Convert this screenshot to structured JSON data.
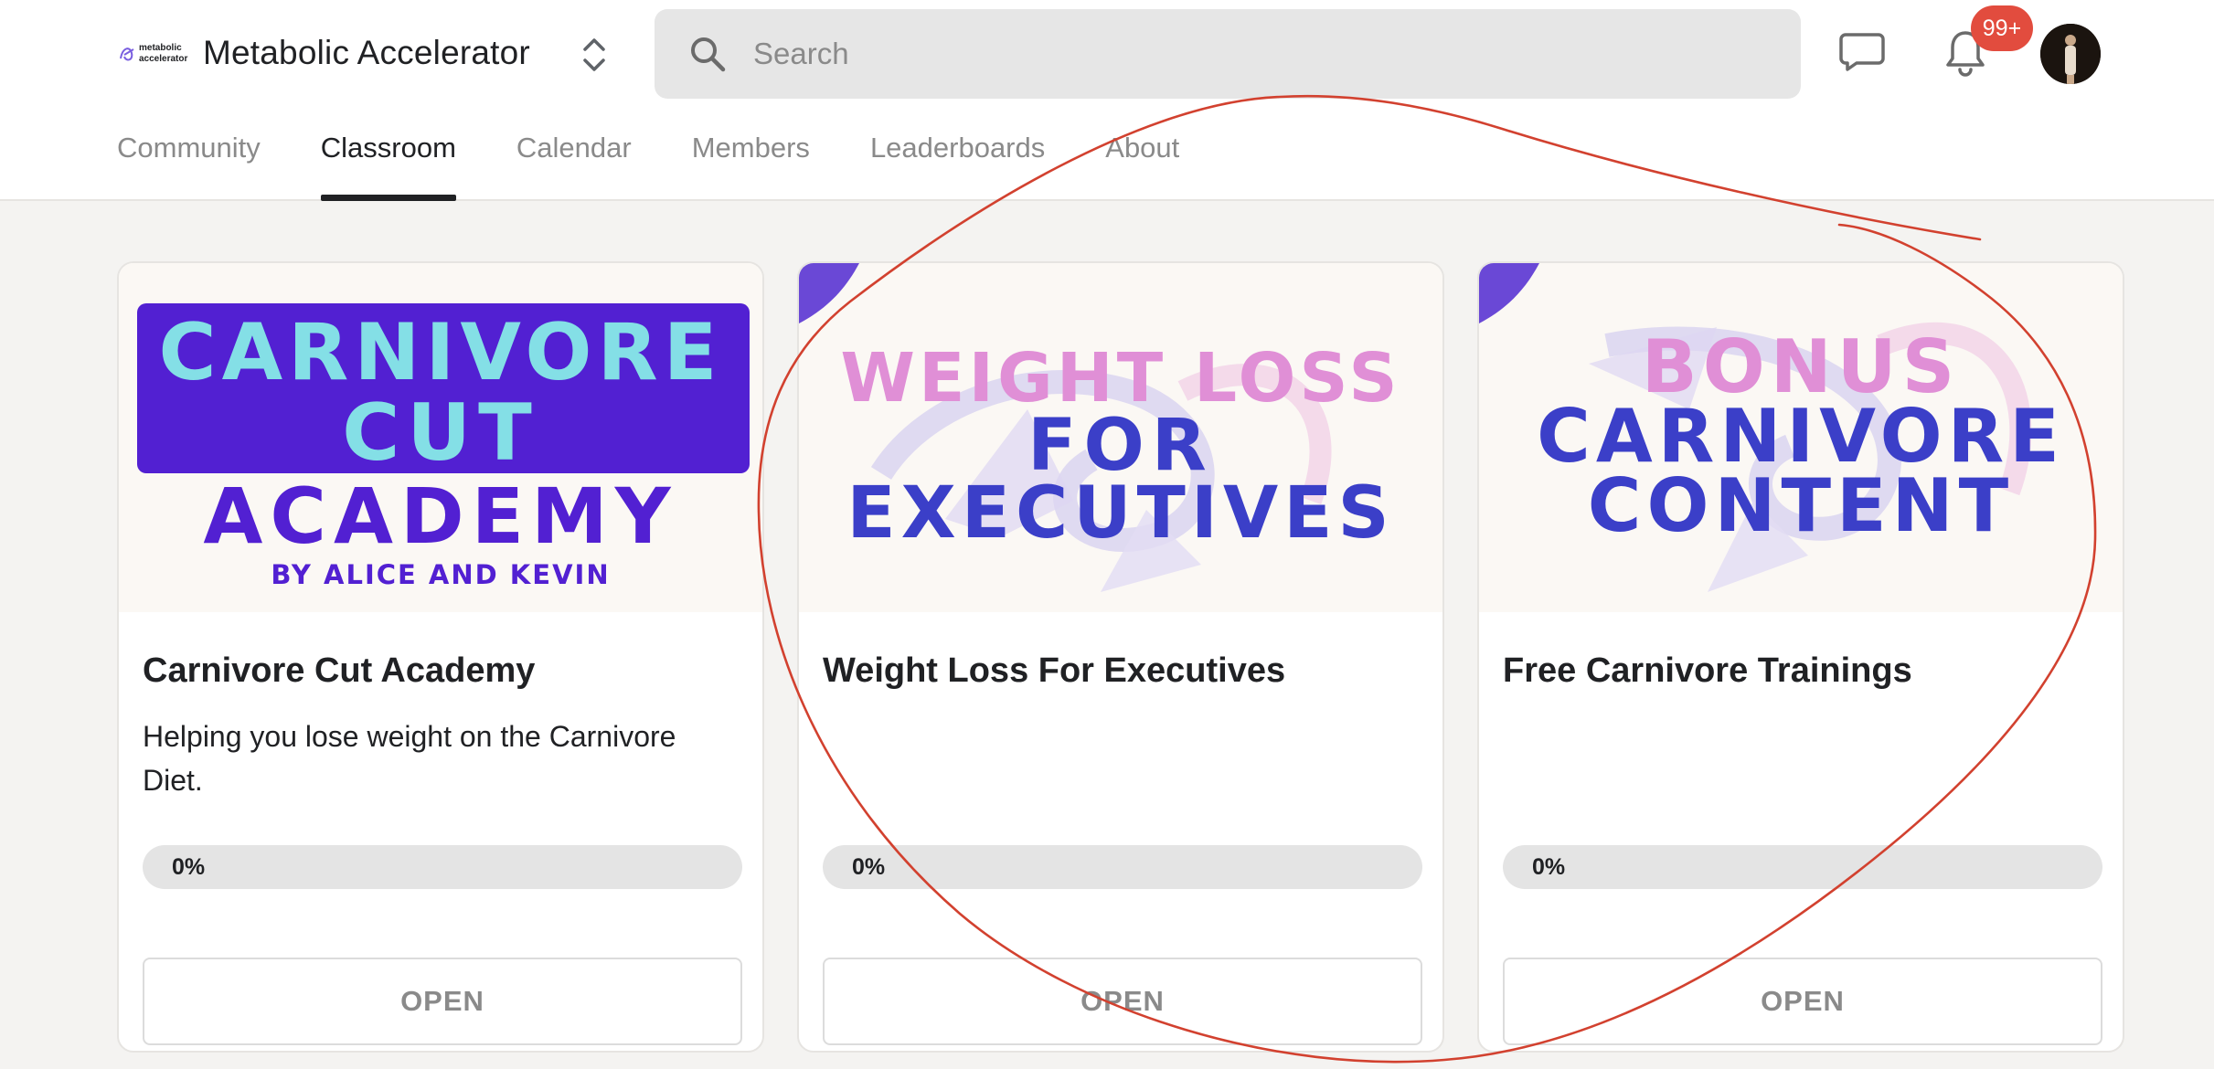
{
  "header": {
    "brand_logo_text": [
      "metabolic",
      "accelerator"
    ],
    "brand_name": "Metabolic Accelerator",
    "search_placeholder": "Search",
    "notification_count": "99+",
    "icons": {
      "switcher": "chevron-up-down-icon",
      "search": "search-icon",
      "chat": "chat-icon",
      "notifications": "bell-icon"
    }
  },
  "tabs": [
    {
      "label": "Community",
      "active": false
    },
    {
      "label": "Classroom",
      "active": true
    },
    {
      "label": "Calendar",
      "active": false
    },
    {
      "label": "Members",
      "active": false
    },
    {
      "label": "Leaderboards",
      "active": false
    },
    {
      "label": "About",
      "active": false
    }
  ],
  "courses": [
    {
      "poster": {
        "lines": [
          "CARNIVORE",
          "CUT",
          "ACADEMY",
          "BY ALICE AND KEVIN"
        ]
      },
      "title": "Carnivore Cut Academy",
      "description": "Helping you lose weight on the Carnivore Diet.",
      "progress_label": "0%",
      "progress": 0,
      "button": "OPEN"
    },
    {
      "poster": {
        "lines": [
          "WEIGHT LOSS",
          "FOR",
          "EXECUTIVES"
        ]
      },
      "title": "Weight Loss For Executives",
      "description": "",
      "progress_label": "0%",
      "progress": 0,
      "button": "OPEN"
    },
    {
      "poster": {
        "lines": [
          "BONUS",
          "CARNIVORE",
          "CONTENT"
        ]
      },
      "title": "Free Carnivore Trainings",
      "description": "",
      "progress_label": "0%",
      "progress": 0,
      "button": "OPEN"
    }
  ],
  "colors": {
    "accent_dark": "#202124",
    "muted": "#8a8a8a",
    "badge": "#e24c3e",
    "poster_purple": "#5220d2",
    "poster_cyan": "#84dfe6",
    "poster_pink": "#e08fd6",
    "poster_blue": "#3b3fc8",
    "corner_purple": "#6a48d6",
    "annotation_red": "#d2412f"
  }
}
